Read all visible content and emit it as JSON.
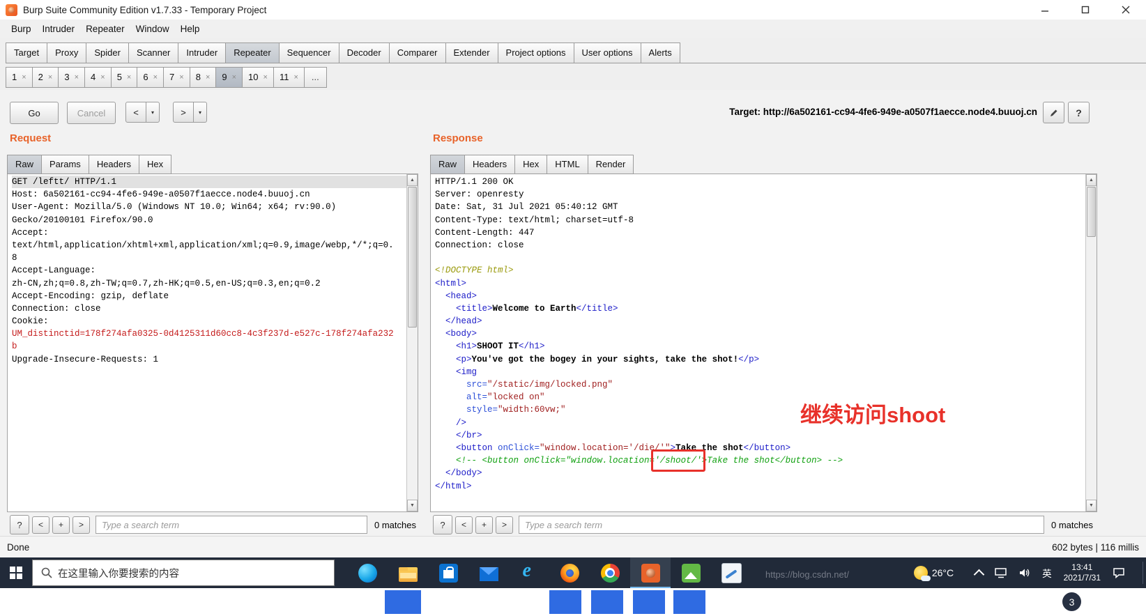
{
  "window": {
    "title": "Burp Suite Community Edition v1.7.33 - Temporary Project"
  },
  "menu": {
    "items": [
      "Burp",
      "Intruder",
      "Repeater",
      "Window",
      "Help"
    ]
  },
  "main_tabs": {
    "items": [
      "Target",
      "Proxy",
      "Spider",
      "Scanner",
      "Intruder",
      "Repeater",
      "Sequencer",
      "Decoder",
      "Comparer",
      "Extender",
      "Project options",
      "User options",
      "Alerts"
    ],
    "active": "Repeater"
  },
  "session_tabs": {
    "items": [
      "1",
      "2",
      "3",
      "4",
      "5",
      "6",
      "7",
      "8",
      "9",
      "10",
      "11"
    ],
    "active": "9",
    "close_glyph": "×",
    "overflow": "..."
  },
  "toolbar": {
    "go": "Go",
    "cancel": "Cancel",
    "back": "<",
    "forward": ">",
    "caret": "▾",
    "target_label": "Target:",
    "target_url": "http://6a502161-cc94-4fe6-949e-a0507f1aecce.node4.buuoj.cn",
    "help": "?"
  },
  "request": {
    "title": "Request",
    "tabs": [
      "Raw",
      "Params",
      "Headers",
      "Hex"
    ],
    "active_tab": "Raw",
    "search": {
      "help": "?",
      "prev": "<",
      "add": "+",
      "next": ">",
      "placeholder": "Type a search term",
      "matches": "0 matches"
    },
    "lines": [
      {
        "sel": true,
        "s": [
          {
            "t": "GET /leftt/ HTTP/1.1",
            "c": "p"
          }
        ]
      },
      {
        "s": [
          {
            "t": "Host: 6a502161-cc94-4fe6-949e-a0507f1aecce.node4.buuoj.cn",
            "c": "p"
          }
        ]
      },
      {
        "s": [
          {
            "t": "User-Agent: Mozilla/5.0 (Windows NT 10.0; Win64; x64; rv:90.0)",
            "c": "p"
          }
        ]
      },
      {
        "s": [
          {
            "t": "Gecko/20100101 Firefox/90.0",
            "c": "p"
          }
        ]
      },
      {
        "s": [
          {
            "t": "Accept:",
            "c": "p"
          }
        ]
      },
      {
        "s": [
          {
            "t": "text/html,application/xhtml+xml,application/xml;q=0.9,image/webp,*/*;q=0.",
            "c": "p"
          }
        ]
      },
      {
        "s": [
          {
            "t": "8",
            "c": "p"
          }
        ]
      },
      {
        "s": [
          {
            "t": "Accept-Language:",
            "c": "p"
          }
        ]
      },
      {
        "s": [
          {
            "t": "zh-CN,zh;q=0.8,zh-TW;q=0.7,zh-HK;q=0.5,en-US;q=0.3,en;q=0.2",
            "c": "p"
          }
        ]
      },
      {
        "s": [
          {
            "t": "Accept-Encoding: gzip, deflate",
            "c": "p"
          }
        ]
      },
      {
        "s": [
          {
            "t": "Connection: close",
            "c": "p"
          }
        ]
      },
      {
        "s": [
          {
            "t": "Cookie:",
            "c": "p"
          }
        ]
      },
      {
        "s": [
          {
            "t": "UM_distinctid=178f274afa0325-0d4125311d60cc8-4c3f237d-e527c-178f274afa232",
            "c": "red"
          }
        ]
      },
      {
        "s": [
          {
            "t": "b",
            "c": "red"
          }
        ]
      },
      {
        "s": [
          {
            "t": "Upgrade-Insecure-Requests: 1",
            "c": "p"
          }
        ]
      }
    ]
  },
  "response": {
    "title": "Response",
    "tabs": [
      "Raw",
      "Headers",
      "Hex",
      "HTML",
      "Render"
    ],
    "active_tab": "Raw",
    "search": {
      "help": "?",
      "prev": "<",
      "add": "+",
      "next": ">",
      "placeholder": "Type a search term",
      "matches": "0 matches"
    },
    "lines": [
      {
        "s": [
          {
            "t": "HTTP/1.1 200 OK",
            "c": "p"
          }
        ]
      },
      {
        "s": [
          {
            "t": "Server: openresty",
            "c": "p"
          }
        ]
      },
      {
        "s": [
          {
            "t": "Date: Sat, 31 Jul 2021 05:40:12 GMT",
            "c": "p"
          }
        ]
      },
      {
        "s": [
          {
            "t": "Content-Type: text/html; charset=utf-8",
            "c": "p"
          }
        ]
      },
      {
        "s": [
          {
            "t": "Content-Length: 447",
            "c": "p"
          }
        ]
      },
      {
        "s": [
          {
            "t": "Connection: close",
            "c": "p"
          }
        ]
      },
      {
        "s": []
      },
      {
        "s": [
          {
            "t": "<!DOCTYPE html>",
            "c": "doc"
          }
        ]
      },
      {
        "s": [
          {
            "t": "<html>",
            "c": "tag"
          }
        ]
      },
      {
        "s": [
          {
            "t": "  <head>",
            "c": "tag"
          }
        ]
      },
      {
        "s": [
          {
            "t": "    <title>",
            "c": "tag"
          },
          {
            "t": "Welcome to Earth",
            "c": "txt"
          },
          {
            "t": "</title>",
            "c": "tag"
          }
        ]
      },
      {
        "s": [
          {
            "t": "  </head>",
            "c": "tag"
          }
        ]
      },
      {
        "s": [
          {
            "t": "  <body>",
            "c": "tag"
          }
        ]
      },
      {
        "s": [
          {
            "t": "    <h1>",
            "c": "tag"
          },
          {
            "t": "SHOOT IT",
            "c": "txt"
          },
          {
            "t": "</h1>",
            "c": "tag"
          }
        ]
      },
      {
        "s": [
          {
            "t": "    <p>",
            "c": "tag"
          },
          {
            "t": "You've got the bogey in your sights, take the shot!",
            "c": "txt"
          },
          {
            "t": "</p>",
            "c": "tag"
          }
        ]
      },
      {
        "s": [
          {
            "t": "    <img",
            "c": "tag"
          }
        ]
      },
      {
        "s": [
          {
            "t": "      src=",
            "c": "attr"
          },
          {
            "t": "\"/static/img/locked.png\"",
            "c": "val"
          }
        ]
      },
      {
        "s": [
          {
            "t": "      alt=",
            "c": "attr"
          },
          {
            "t": "\"locked on\"",
            "c": "val"
          }
        ]
      },
      {
        "s": [
          {
            "t": "      style=",
            "c": "attr"
          },
          {
            "t": "\"width:60vw;\"",
            "c": "val"
          }
        ]
      },
      {
        "s": [
          {
            "t": "    />",
            "c": "tag"
          }
        ]
      },
      {
        "s": [
          {
            "t": "    </br>",
            "c": "tag"
          }
        ]
      },
      {
        "s": [
          {
            "t": "    <button ",
            "c": "tag"
          },
          {
            "t": "onClick=",
            "c": "attr"
          },
          {
            "t": "\"window.location='/die/'\"",
            "c": "val"
          },
          {
            "t": ">",
            "c": "tag"
          },
          {
            "t": "Take the shot",
            "c": "txt"
          },
          {
            "t": "</button>",
            "c": "tag"
          }
        ]
      },
      {
        "s": [
          {
            "t": "    <!-- <button onClick=\"window.location=",
            "c": "com"
          },
          {
            "t": "'/shoot/'",
            "c": "box"
          },
          {
            "t": ">Take the shot</button> -->",
            "c": "com"
          }
        ]
      },
      {
        "s": [
          {
            "t": "  </body>",
            "c": "tag"
          }
        ]
      },
      {
        "s": [
          {
            "t": "</html>",
            "c": "tag"
          }
        ]
      }
    ]
  },
  "annotation": {
    "text": "继续访问shoot"
  },
  "status": {
    "left": "Done",
    "right": "602 bytes | 116 millis"
  },
  "taskbar": {
    "search_placeholder": "在这里输入你要搜索的内容",
    "icons": [
      "edge",
      "file-explorer",
      "store",
      "mail",
      "internet-explorer",
      "firefox",
      "chrome",
      "burp",
      "image-viewer",
      "notepad"
    ],
    "tray": {
      "temp": "26°C",
      "lang": "英",
      "time": "13:41",
      "date": "2021/7/31",
      "badge": "3"
    }
  },
  "watermark": "https://blog.csdn.net/"
}
